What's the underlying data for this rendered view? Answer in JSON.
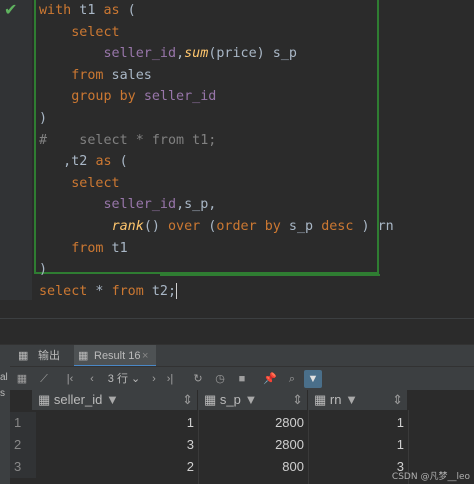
{
  "editor": {
    "lines": [
      [
        [
          "kw",
          "with"
        ],
        [
          "t",
          " t1 "
        ],
        [
          "kw",
          "as"
        ],
        [
          "t",
          " ("
        ]
      ],
      [
        [
          "t",
          "    "
        ],
        [
          "kw",
          "select"
        ]
      ],
      [
        [
          "t",
          "        "
        ],
        [
          "ident",
          "seller_id"
        ],
        [
          "t",
          ","
        ],
        [
          "fn",
          "sum"
        ],
        [
          "t",
          "(price) s_p"
        ]
      ],
      [
        [
          "t",
          "    "
        ],
        [
          "kw",
          "from"
        ],
        [
          "t",
          " sales"
        ]
      ],
      [
        [
          "t",
          "    "
        ],
        [
          "kw",
          "group by"
        ],
        [
          "t",
          " "
        ],
        [
          "ident",
          "seller_id"
        ]
      ],
      [
        [
          "t",
          ")"
        ]
      ],
      [
        [
          "comment",
          "#    select * from t1;"
        ]
      ],
      [
        [
          "t",
          "   ,t2 "
        ],
        [
          "kw",
          "as"
        ],
        [
          "t",
          " ("
        ]
      ],
      [
        [
          "t",
          "    "
        ],
        [
          "kw",
          "select"
        ]
      ],
      [
        [
          "t",
          "        "
        ],
        [
          "ident",
          "seller_id"
        ],
        [
          "t",
          ",s_p,"
        ]
      ],
      [
        [
          "t",
          "         "
        ],
        [
          "fn",
          "rank"
        ],
        [
          "t",
          "() "
        ],
        [
          "kw",
          "over"
        ],
        [
          "t",
          " ("
        ],
        [
          "kw",
          "order by"
        ],
        [
          "t",
          " s_p "
        ],
        [
          "kw",
          "desc"
        ],
        [
          "t",
          " ) rn"
        ]
      ],
      [
        [
          "t",
          "    "
        ],
        [
          "kw",
          "from"
        ],
        [
          "t",
          " t1"
        ]
      ],
      [
        [
          "t",
          ")"
        ]
      ],
      [
        [
          "kw",
          "select"
        ],
        [
          "t",
          " * "
        ],
        [
          "kw",
          "from"
        ],
        [
          "t",
          " t2;"
        ]
      ]
    ]
  },
  "tabs": {
    "output_label": "输出",
    "result_label": "Result 16"
  },
  "toolbar": {
    "rows_label": "3 行"
  },
  "grid": {
    "columns": [
      "seller_id",
      "s_p",
      "rn"
    ],
    "rows": [
      {
        "num": "1",
        "seller_id": "1",
        "s_p": "2800",
        "rn": "1"
      },
      {
        "num": "2",
        "seller_id": "3",
        "s_p": "2800",
        "rn": "1"
      },
      {
        "num": "3",
        "seller_id": "2",
        "s_p": "800",
        "rn": "3"
      }
    ]
  },
  "left_strip": {
    "labels": [
      "al",
      "s"
    ]
  },
  "watermark": "CSDN @凡梦__leo"
}
